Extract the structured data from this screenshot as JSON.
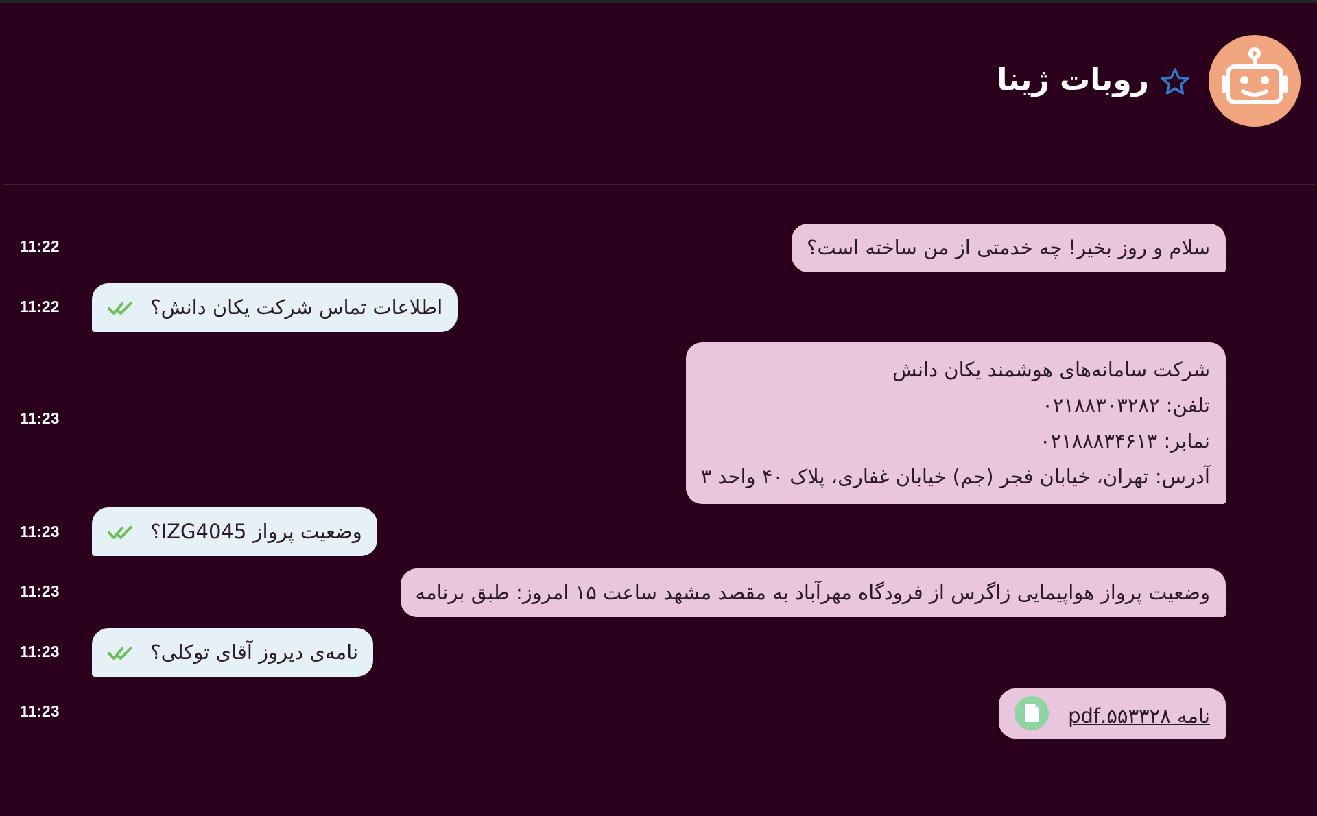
{
  "header": {
    "title": "روبات ژینا",
    "avatar_icon": "robot-icon",
    "favorite_icon": "star-outline-icon"
  },
  "colors": {
    "background": "#2a001d",
    "bot_bubble": "#eac6dc",
    "user_bubble": "#e6f0f7",
    "avatar": "#f0a57e",
    "check": "#6bbf59"
  },
  "messages": [
    {
      "sender": "bot",
      "text": "سلام و روز بخیر! چه خدمتی از من ساخته است؟",
      "time": "11:22"
    },
    {
      "sender": "user",
      "text": "اطلاعات تماس شرکت یکان دانش؟",
      "time": "11:22",
      "status_icon": "double-check-icon"
    },
    {
      "sender": "bot",
      "lines": [
        "شرکت سامانه‌های هوشمند یکان دانش",
        "تلفن: ۰۲۱۸۸۳۰۳۲۸۲",
        "نمابر: ۰۲۱۸۸۸۳۴۶۱۳",
        "آدرس: تهران، خیابان فجر (جم) خیابان غفاری، پلاک ۴۰ واحد ۳"
      ],
      "time": "11:23"
    },
    {
      "sender": "user",
      "text": "وضعیت پرواز IZG4045؟",
      "time": "11:23",
      "status_icon": "double-check-icon"
    },
    {
      "sender": "bot",
      "text": "وضعیت پرواز هواپیمایی زاگرس از فرودگاه مهرآباد به مقصد مشهد ساعت ۱۵ امروز: طبق برنامه",
      "time": "11:23"
    },
    {
      "sender": "user",
      "text": "نامه‌ی دیروز آقای توکلی؟",
      "time": "11:23",
      "status_icon": "double-check-icon"
    },
    {
      "sender": "bot",
      "file_name": "نامه ۵۵۳۳۲۸.pdf",
      "file_icon": "document-icon",
      "time": "11:23"
    }
  ]
}
